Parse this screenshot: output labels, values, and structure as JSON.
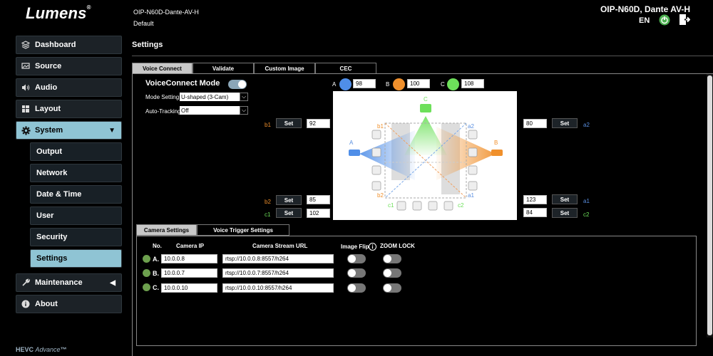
{
  "header": {
    "brand": "Lumens",
    "device_name": "OIP-N60D-Dante-AV-H",
    "device_sub": "Default",
    "model": "OIP-N60D, Dante AV-H",
    "language": "EN"
  },
  "sidebar": {
    "items": [
      {
        "label": "Dashboard",
        "icon": "layers-icon"
      },
      {
        "label": "Source",
        "icon": "source-icon"
      },
      {
        "label": "Audio",
        "icon": "speaker-icon"
      },
      {
        "label": "Layout",
        "icon": "grid-icon"
      },
      {
        "label": "System",
        "icon": "gear-icon"
      },
      {
        "label": "Maintenance",
        "icon": "wrench-icon"
      },
      {
        "label": "About",
        "icon": "info-icon"
      }
    ],
    "system_sub": [
      "Output",
      "Network",
      "Date & Time",
      "User",
      "Security",
      "Settings"
    ],
    "footer": "HEVC",
    "footer_suffix": "Advance"
  },
  "main": {
    "title": "Settings",
    "tabs": [
      "Voice Connect",
      "Validate",
      "Custom Image",
      "CEC"
    ],
    "active_tab": "Voice Connect",
    "voice_connect": {
      "mode_label": "VoiceConnect Mode",
      "mode_on": true,
      "mode_setting_label": "Mode Setting",
      "mode_setting_value": "U-shaped (3-Cam)",
      "auto_tracking_label": "Auto-Tracking",
      "auto_tracking_value": "Off",
      "cameras": [
        {
          "id": "A",
          "value": "98",
          "color": "#4f8ee8"
        },
        {
          "id": "B",
          "value": "100",
          "color": "#f0902c"
        },
        {
          "id": "C",
          "value": "108",
          "color": "#6de05a"
        }
      ],
      "zones_left": [
        {
          "label": "b1",
          "value": "92"
        },
        {
          "label": "b2",
          "value": "85"
        },
        {
          "label": "c1",
          "value": "102"
        }
      ],
      "zones_right": [
        {
          "label": "a2",
          "value": "80"
        },
        {
          "label": "a1",
          "value": "123"
        },
        {
          "label": "c2",
          "value": "84"
        }
      ],
      "set_label": "Set",
      "diagram_labels": {
        "b1": "b1",
        "b2": "b2",
        "a1": "a1",
        "a2": "a2",
        "c1": "c1",
        "c2": "c2",
        "A": "A",
        "B": "B",
        "C": "C"
      }
    },
    "lower_tabs": [
      "Camera Settings",
      "Voice Trigger Settings"
    ],
    "camera_table": {
      "headers": [
        "No.",
        "Camera IP",
        "Camera Stream URL",
        "Image Flip",
        "ZOOM LOCK"
      ],
      "rows": [
        {
          "no": "A.",
          "ip": "10.0.0.8",
          "url": "rtsp://10.0.0.8:8557/h264"
        },
        {
          "no": "B.",
          "ip": "10.0.0.7",
          "url": "rtsp://10.0.0.7:8557/h264"
        },
        {
          "no": "C.",
          "ip": "10.0.0.10",
          "url": "rtsp://10.0.0.10:8557/h264"
        }
      ]
    }
  },
  "colors": {
    "accent": "#8fc4d4",
    "status_green": "#6da04e",
    "power_green": "#4caf50"
  }
}
